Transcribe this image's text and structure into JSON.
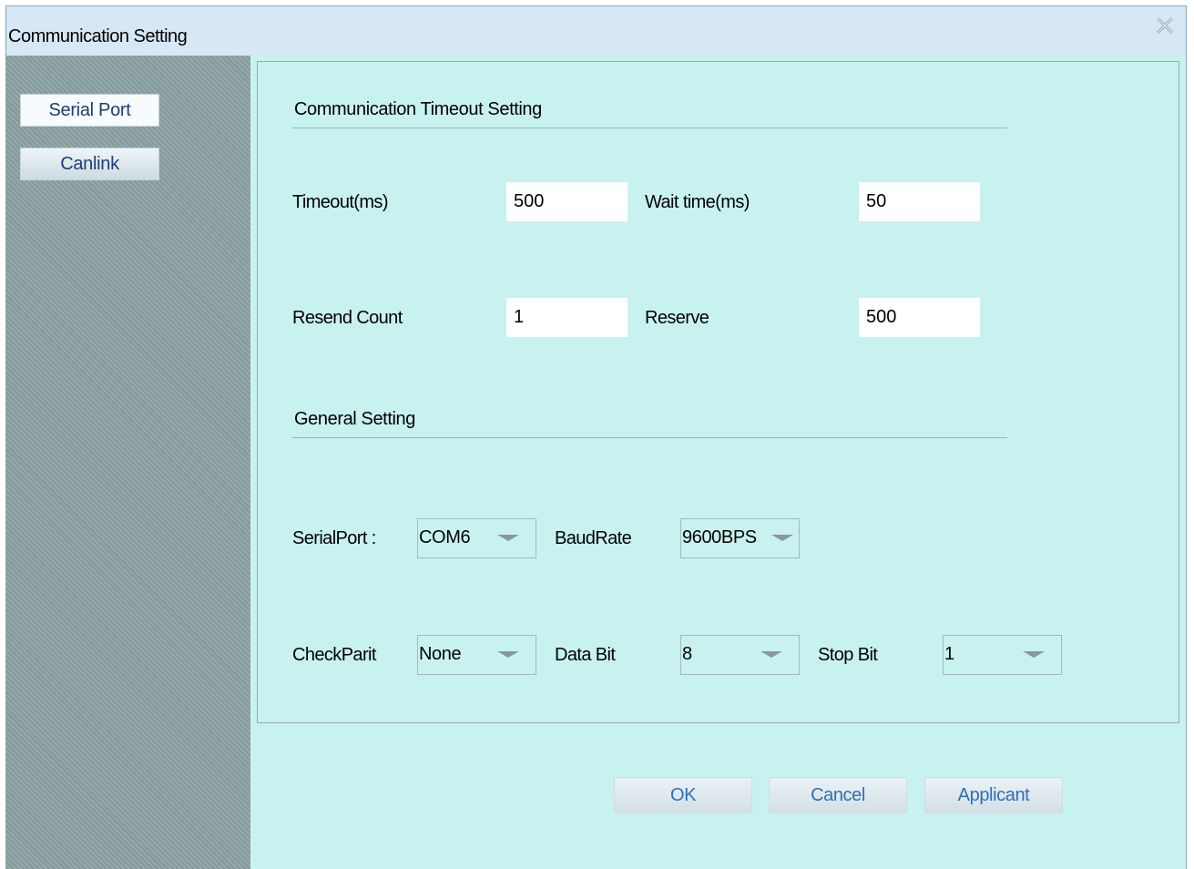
{
  "window": {
    "title": "Communication Setting"
  },
  "sidebar": {
    "items": [
      {
        "label": "Serial Port",
        "active": true
      },
      {
        "label": "Canlink",
        "active": false
      }
    ]
  },
  "timeout_section": {
    "title": "Communication Timeout Setting",
    "timeout_label": "Timeout(ms)",
    "timeout_value": "500",
    "wait_label": "Wait time(ms)",
    "wait_value": "50",
    "resend_label": "Resend Count",
    "resend_value": "1",
    "reserve_label": "Reserve",
    "reserve_value": "500"
  },
  "general_section": {
    "title": "General Setting",
    "serialport_label": "SerialPort :",
    "serialport_value": "COM6",
    "baudrate_label": "BaudRate",
    "baudrate_value": "9600BPS",
    "checkparity_label": "CheckParit",
    "checkparity_value": "None",
    "databit_label": "Data Bit",
    "databit_value": "8",
    "stopbit_label": "Stop Bit",
    "stopbit_value": "1"
  },
  "buttons": {
    "ok": "OK",
    "cancel": "Cancel",
    "apply": "Applicant"
  },
  "colors": {
    "panel_background": "#c8f2f0",
    "titlebar": "#d6e8f5",
    "sidebar": "#869c9c",
    "button_text": "#2f6eb8"
  },
  "icons": {
    "close": "close-icon"
  }
}
